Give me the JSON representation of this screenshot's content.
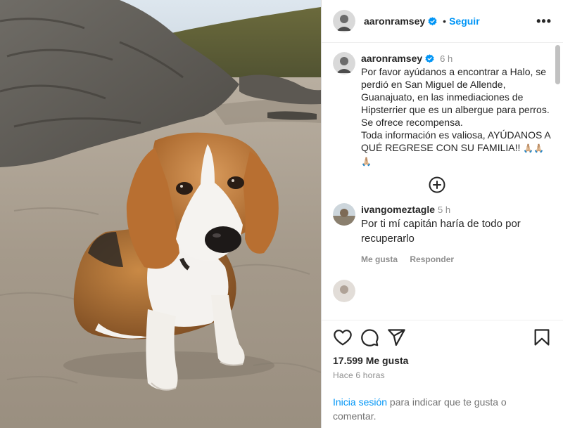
{
  "post": {
    "author": "aaronramsey",
    "header_follow": "Seguir",
    "caption_time": "6 h",
    "caption_text": "Por favor ayúdanos a encontrar a Halo, se perdió en San Miguel de Allende, Guanajuato, en las inmediaciones de Hipsterrier que es un albergue para perros.  Se ofrece recompensa.\nToda información es valiosa, AYÚDANOS A QUÉ REGRESE CON SU FAMILIA!! ",
    "caption_emojis": "🙏🏼🙏🏼🙏🏼"
  },
  "comments": [
    {
      "author": "ivangomeztagle",
      "time": "5 h",
      "text": "Por ti mí capitán haría de todo por recuperarlo",
      "like_label": "Me gusta",
      "reply_label": "Responder"
    }
  ],
  "stats": {
    "likes": "17.599 Me gusta",
    "time_ago": "Hace 6 horas"
  },
  "login": {
    "link": "Inicia sesión",
    "rest": " para indicar que te gusta o comentar."
  },
  "icons": {
    "more": "more-options-icon",
    "verified": "verified-badge-icon",
    "load_more": "plus-circle-icon",
    "like": "heart-icon",
    "comment": "comment-bubble-icon",
    "share": "paper-plane-icon",
    "save": "bookmark-icon"
  },
  "colors": {
    "link_blue": "#0095f6",
    "muted": "#8e8e8e"
  }
}
